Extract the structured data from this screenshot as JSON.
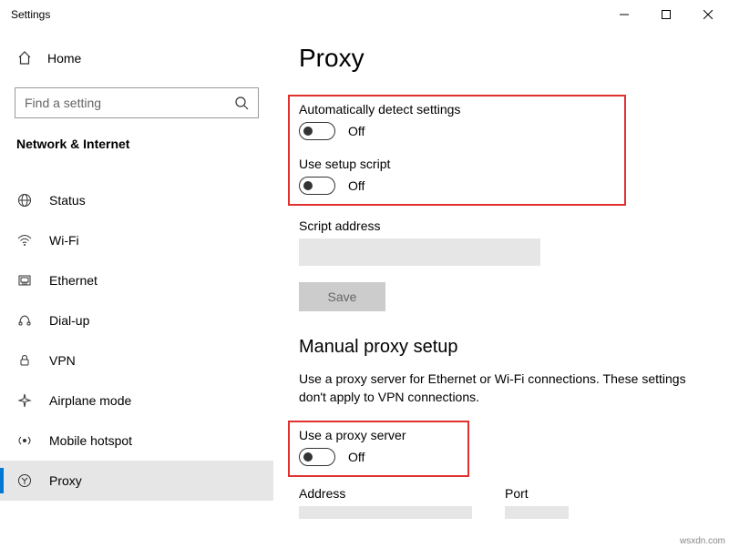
{
  "window": {
    "title": "Settings"
  },
  "sidebar": {
    "home_label": "Home",
    "search_placeholder": "Find a setting",
    "category_label": "Network & Internet",
    "items": [
      {
        "label": "Status"
      },
      {
        "label": "Wi-Fi"
      },
      {
        "label": "Ethernet"
      },
      {
        "label": "Dial-up"
      },
      {
        "label": "VPN"
      },
      {
        "label": "Airplane mode"
      },
      {
        "label": "Mobile hotspot"
      },
      {
        "label": "Proxy"
      }
    ]
  },
  "page": {
    "title": "Proxy",
    "auto_detect_label": "Automatically detect settings",
    "auto_detect_state": "Off",
    "use_script_label": "Use setup script",
    "use_script_state": "Off",
    "script_addr_label": "Script address",
    "script_addr_value": "",
    "save_label": "Save",
    "manual_header": "Manual proxy setup",
    "manual_desc": "Use a proxy server for Ethernet or Wi-Fi connections. These settings don't apply to VPN connections.",
    "use_proxy_label": "Use a proxy server",
    "use_proxy_state": "Off",
    "address_label": "Address",
    "address_value": "",
    "port_label": "Port",
    "port_value": ""
  },
  "watermark": "wsxdn.com"
}
